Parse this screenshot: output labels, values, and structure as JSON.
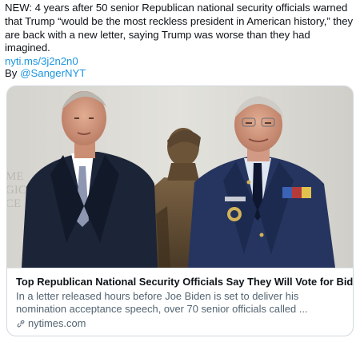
{
  "tweet": {
    "text": "NEW: 4 years after 50 senior Republican national security officials warned that Trump “would be the most reckless president in American history,” they are back with a new letter, saying Trump was worse than they had imagined.",
    "link": "nyti.ms/3j2n2n0",
    "by_prefix": "By ",
    "author_handle": "@SangerNYT"
  },
  "card": {
    "image_icon": "photo-two-men-and-bronze-statue",
    "title": "Top Republican National Security Officials Say They Will Vote for Biden",
    "description": "In a letter released hours before Joe Biden is set to deliver his nomination acceptance speech, over 70 senior officials called ...",
    "domain": "nytimes.com",
    "domain_icon": "link-icon"
  },
  "colors": {
    "link": "#1b95e0",
    "text": "#0f1419",
    "muted": "#536471",
    "border": "#cfd9de"
  }
}
